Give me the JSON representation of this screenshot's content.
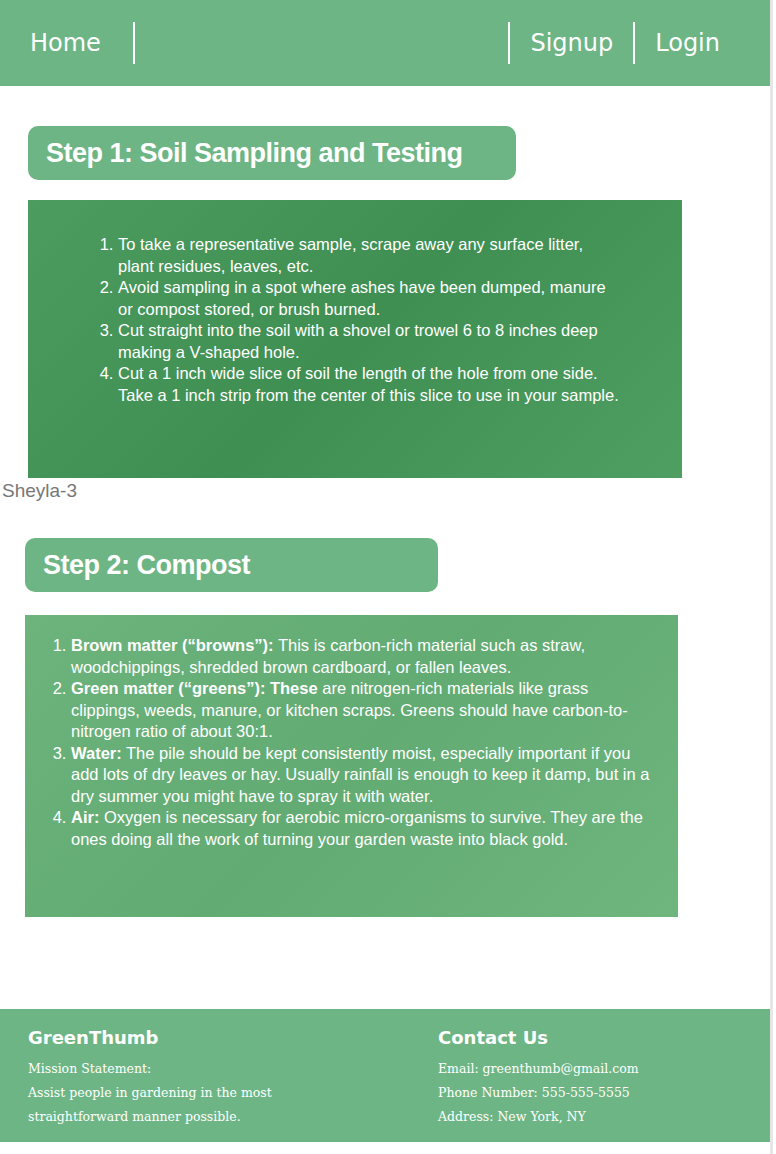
{
  "nav": {
    "left": [
      {
        "label": "Home"
      }
    ],
    "right": [
      {
        "label": "Signup"
      },
      {
        "label": "Login"
      }
    ]
  },
  "steps": [
    {
      "title": "Step 1:  Soil Sampling and Testing",
      "items": [
        {
          "term": "",
          "text": "To take a representative sample, scrape away any surface litter, plant residues, leaves, etc."
        },
        {
          "term": "",
          "text": "Avoid sampling in a spot where ashes have been dumped, manure or compost stored, or brush burned."
        },
        {
          "term": "",
          "text": "Cut straight into the soil with a shovel or trowel 6 to 8 inches deep making a V-shaped hole."
        },
        {
          "term": "",
          "text": "Cut a 1 inch wide slice of soil the length of the hole from one side. Take a 1 inch strip from the center of this slice to use in your sample."
        }
      ]
    },
    {
      "title": "Step 2: Compost",
      "items": [
        {
          "term": "Brown matter (“browns”):",
          "text": " This is carbon-rich material such as straw, woodchippings, shredded brown cardboard, or fallen leaves."
        },
        {
          "term": "Green matter (“greens”): These",
          "text": " are nitrogen-rich materials like grass clippings, weeds, manure, or kitchen scraps. Greens should have carbon-to-nitrogen ratio of about 30:1."
        },
        {
          "term": "Water:",
          "text": " The pile should be kept consistently moist, especially important if you add lots of dry leaves or hay. Usually rainfall is enough to keep it damp, but in a dry summer you might have to spray it with water."
        },
        {
          "term": "Air:",
          "text": " Oxygen is necessary for aerobic micro-organisms to survive. They are the ones doing all the work of turning your garden waste into black gold."
        }
      ]
    }
  ],
  "frame_label": "Sheyla-3",
  "footer": {
    "brand": "GreenThumb",
    "mission_label": "Mission Statement:",
    "mission": "Assist people in gardening in the most straightforward manner possible.",
    "contact_title": "Contact Us",
    "contact_lines": [
      "Email: greenthumb@gmail.com",
      "Phone Number: 555-555-5555",
      "Address: New York, NY"
    ]
  }
}
